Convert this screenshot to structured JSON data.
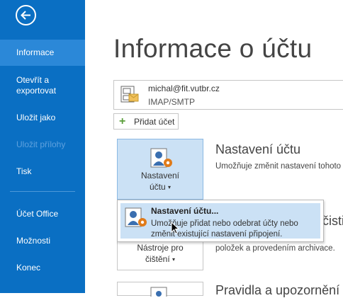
{
  "sidebar": {
    "back_icon": "back-arrow-icon",
    "items": [
      {
        "label": "Informace",
        "selected": true,
        "disabled": false
      },
      {
        "label": "Otevřít a",
        "label2": "exportovat",
        "selected": false,
        "disabled": false
      },
      {
        "label": "Uložit jako",
        "selected": false,
        "disabled": false
      },
      {
        "label": "Uložit přílohy",
        "selected": false,
        "disabled": true
      },
      {
        "label": "Tisk",
        "selected": false,
        "disabled": false
      },
      {
        "label": "Účet Office",
        "selected": false,
        "disabled": false
      },
      {
        "label": "Možnosti",
        "selected": false,
        "disabled": false
      },
      {
        "label": "Konec",
        "selected": false,
        "disabled": false
      }
    ]
  },
  "main": {
    "title": "Informace o účtu",
    "account": {
      "email": "michal@fit.vutbr.cz",
      "type": "IMAP/SMTP",
      "icon": "mail-account-icon"
    },
    "add_account_label": "Přidat účet",
    "sections": [
      {
        "tile_line1": "Nastavení",
        "tile_line2": "účtu",
        "caret": "▾",
        "title": "Nastavení účtu",
        "desc": "Umožňuje změnit nastavení tohoto"
      },
      {
        "title_partial": "čisti",
        "tile_line1": "Nástroje pro",
        "tile_line2": "čištění",
        "caret": "▾",
        "desc_line1": "",
        "desc_line2": "položek a provedením archivace."
      },
      {
        "title": "Pravidla a upozornění"
      }
    ],
    "dropdown": {
      "title": "Nastavení účtu...",
      "desc_line1": "Umožňuje přidat nebo odebrat účty nebo",
      "desc_line2": "změnit existující nastavení připojení."
    }
  },
  "colors": {
    "sidebar": "#0a6fc3",
    "selected": "#2b88d8",
    "tile_highlight": "#cbe1f5"
  }
}
